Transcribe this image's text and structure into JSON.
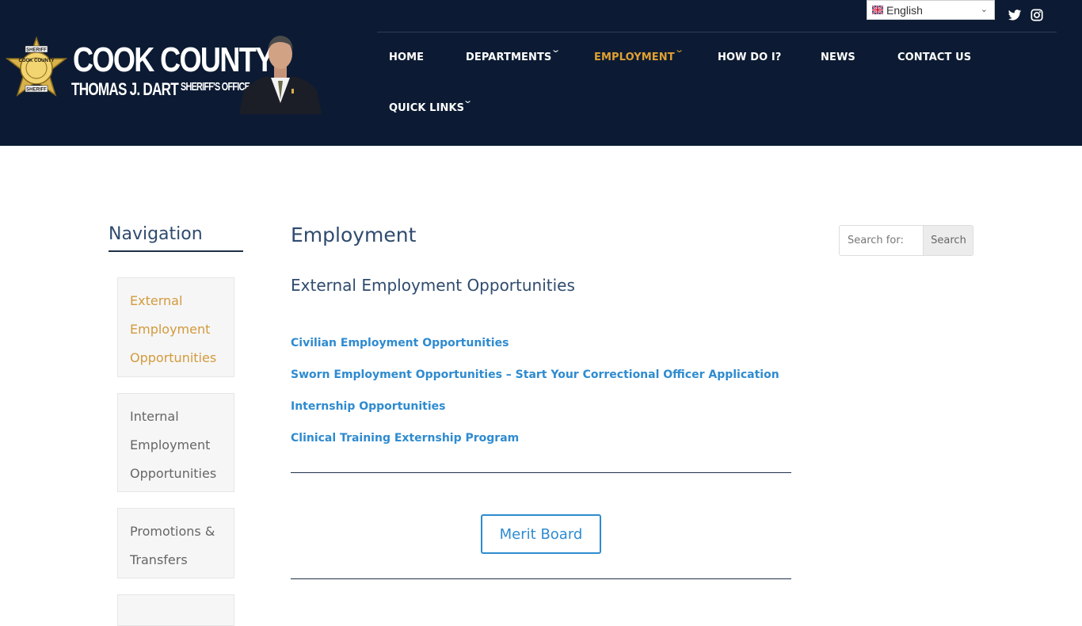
{
  "brand": {
    "badge_top": "SHERIFF",
    "badge_ring": "COOK COUNTY",
    "badge_bottom": "SHERIFF",
    "title": "COOK COUNTY",
    "name": "THOMAS J. DART",
    "office": "SHERIFF'S OFFICE"
  },
  "language": {
    "selected": "English"
  },
  "social": [
    "twitter-icon",
    "instagram-icon"
  ],
  "nav": {
    "home": "HOME",
    "departments": "DEPARTMENTS",
    "employment": "EMPLOYMENT",
    "how_do_i": "HOW DO I?",
    "news": "NEWS",
    "contact": "CONTACT US",
    "quick_links": "QUICK LINKS"
  },
  "sidebar": {
    "heading": "Navigation",
    "items": [
      {
        "label": "External Employment Opportunities",
        "active": true
      },
      {
        "label": "Internal Employment Opportunities",
        "active": false
      },
      {
        "label": "Promotions & Transfers",
        "active": false
      }
    ]
  },
  "main": {
    "title": "Employment",
    "section_title": "External Employment Opportunities",
    "links": [
      "Civilian Employment Opportunities",
      "Sworn Employment Opportunities – Start Your Correctional Officer Application",
      "Internship Opportunities",
      "Clinical Training Externship Program"
    ],
    "merit_button": "Merit Board"
  },
  "search": {
    "placeholder": "Search for:",
    "button": "Search"
  },
  "colors": {
    "header_bg": "#0c1b33",
    "accent_gold": "#e0a032",
    "link_blue": "#2e8bd0",
    "heading_navy": "#2f4b6e"
  }
}
